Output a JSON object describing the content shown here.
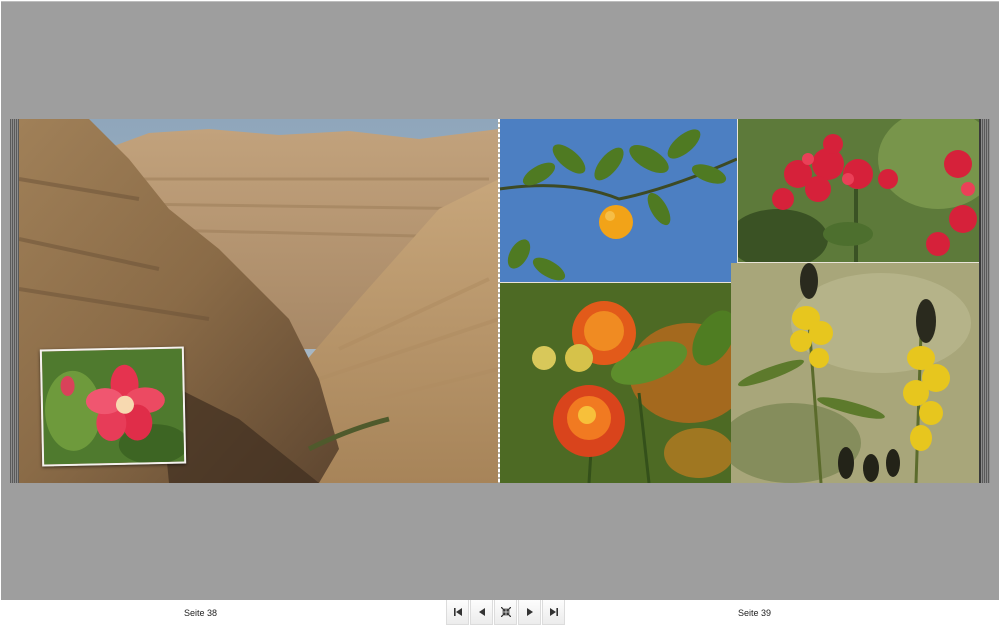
{
  "album": {
    "left_page": {
      "label": "Seite 38",
      "photos": [
        {
          "name": "desert-canyon-photo"
        },
        {
          "name": "desert-rose-photo"
        }
      ]
    },
    "right_page": {
      "label": "Seite 39",
      "photos": [
        {
          "name": "orange-branch-photo"
        },
        {
          "name": "red-blossoms-photo"
        },
        {
          "name": "lantana-photo"
        },
        {
          "name": "yellow-cassia-photo"
        }
      ]
    }
  },
  "navigation": {
    "buttons": [
      {
        "icon": "first-page-icon"
      },
      {
        "icon": "previous-page-icon"
      },
      {
        "icon": "fit-view-icon"
      },
      {
        "icon": "next-page-icon"
      },
      {
        "icon": "last-page-icon"
      }
    ]
  },
  "colors": {
    "viewer_background": "#9e9e9e",
    "toolbar_background": "#ffffff"
  }
}
